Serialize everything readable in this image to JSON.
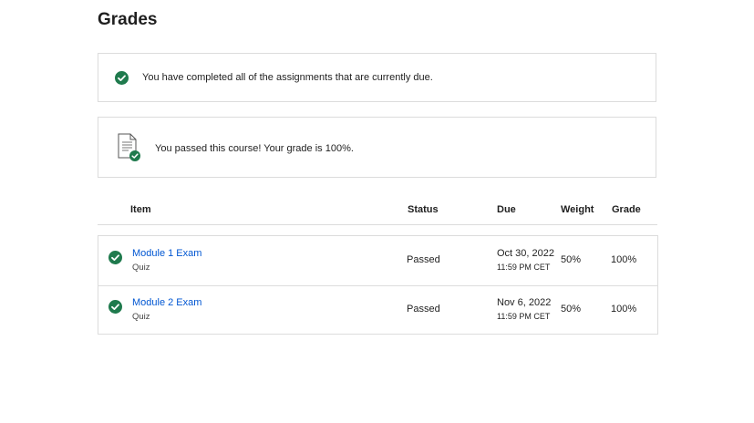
{
  "page": {
    "title": "Grades"
  },
  "colors": {
    "success": "#1f7a4d",
    "link": "#0056d2",
    "border": "#dcdcdc"
  },
  "status_cards": [
    {
      "icon": "check-circle-icon",
      "message": "You have completed all of the assignments that are currently due."
    },
    {
      "icon": "document-check-icon",
      "message": "You passed this course! Your grade is 100%."
    }
  ],
  "table": {
    "headers": {
      "item": "Item",
      "status": "Status",
      "due": "Due",
      "weight": "Weight",
      "grade": "Grade"
    },
    "rows": [
      {
        "name": "Module 1 Exam",
        "type": "Quiz",
        "status": "Passed",
        "due_date": "Oct 30, 2022",
        "due_time": "11:59 PM CET",
        "weight": "50%",
        "grade": "100%"
      },
      {
        "name": "Module 2 Exam",
        "type": "Quiz",
        "status": "Passed",
        "due_date": "Nov 6, 2022",
        "due_time": "11:59 PM CET",
        "weight": "50%",
        "grade": "100%"
      }
    ]
  }
}
